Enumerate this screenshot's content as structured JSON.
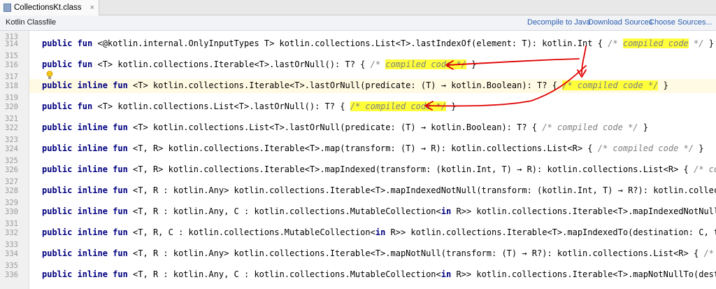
{
  "tab": {
    "title": "CollectionsKt.class",
    "close": "×"
  },
  "infobar": {
    "label": "Kotlin Classfile",
    "decompile": "Decompile to Java",
    "download": "Download Sources",
    "choose": "Choose Sources..."
  },
  "gutter": {
    "numbers": [
      "313",
      "314",
      "315",
      "316",
      "317",
      "318",
      "319",
      "320",
      "321",
      "322",
      "323",
      "324",
      "325",
      "326",
      "327",
      "328",
      "329",
      "330",
      "331",
      "332",
      "333",
      "334",
      "335",
      "336"
    ]
  },
  "code": {
    "l314": {
      "kw": "public fun",
      "rest": " <@kotlin.internal.OnlyInputTypes T> kotlin.collections.List<T>.lastIndexOf(element: T): kotlin.Int { ",
      "c1": "/* ",
      "c2": "compiled code",
      "c3": " */",
      "end": " }"
    },
    "l316": {
      "kw": "public fun",
      "rest": " <T> kotlin.collections.Iterable<T>.lastOrNull(): T? { ",
      "c1": "/* ",
      "c2": "compiled code */",
      "end": " }"
    },
    "l318": {
      "kw": "public inline fun",
      "rest": " <T> kotlin.collections.Iterable<T>.lastOrNull(predicate: (T) → kotlin.Boolean): T? { ",
      "c1": "/* compiled code */",
      "end": " }"
    },
    "l320": {
      "kw": "public fun",
      "rest": " <T> kotlin.collections.List<T>.lastOrNull(): T? { ",
      "c1": "/* compiled code */",
      "end": " }"
    },
    "l322": {
      "kw": "public inline fun",
      "rest": " <T> kotlin.collections.List<T>.lastOrNull(predicate: (T) → kotlin.Boolean): T? { ",
      "c1": "/* compiled code */",
      "end": " }"
    },
    "l324": {
      "kw": "public inline fun",
      "rest": " <T, R> kotlin.collections.Iterable<T>.map(transform: (T) → R): kotlin.collections.List<R> { ",
      "c1": "/* compiled code */",
      "end": " }"
    },
    "l326": {
      "kw": "public inline fun",
      "rest": " <T, R> kotlin.collections.Iterable<T>.mapIndexed(transform: (kotlin.Int, T) → R): kotlin.collections.List<R> { ",
      "c1": "/* compiled code",
      "end": ""
    },
    "l328": {
      "kw": "public inline fun",
      "rest": " <T, R : kotlin.Any> kotlin.collections.Iterable<T>.mapIndexedNotNull(transform: (kotlin.Int, T) → R?): kotlin.collections.List<",
      "end": ""
    },
    "l330": {
      "kw": "public inline fun",
      "rest1": " <T, R : kotlin.Any, C : kotlin.collections.MutableCollection<",
      "kw2": "in",
      "rest2": " R>> kotlin.collections.Iterable<T>.mapIndexedNotNullTo(destinati",
      "end": ""
    },
    "l332": {
      "kw": "public inline fun",
      "rest1": " <T, R, C : kotlin.collections.MutableCollection<",
      "kw2": "in",
      "rest2": " R>> kotlin.collections.Iterable<T>.mapIndexedTo(destination: C, transform: (k",
      "end": ""
    },
    "l334": {
      "kw": "public inline fun",
      "rest": " <T, R : kotlin.Any> kotlin.collections.Iterable<T>.mapNotNull(transform: (T) → R?): kotlin.collections.List<R> { ",
      "c1": "/* compiled",
      "end": ""
    },
    "l336": {
      "kw": "public inline fun",
      "rest1": " <T, R : kotlin.Any, C : kotlin.collections.MutableCollection<",
      "kw2": "in",
      "rest2": " R>> kotlin.collections.Iterable<T>.mapNotNullTo(destination: C, t",
      "end": ""
    }
  },
  "colors": {
    "keyword": "#000080",
    "comment": "#808080",
    "highlight": "#ffff3a",
    "annotation": "#e00000"
  }
}
